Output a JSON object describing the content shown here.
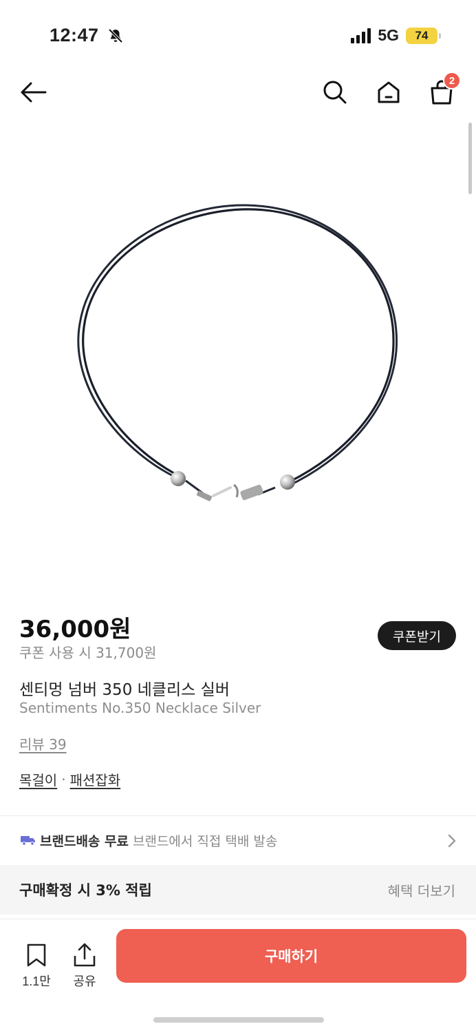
{
  "status_bar": {
    "time": "12:47",
    "network": "5G",
    "battery": "74"
  },
  "nav": {
    "cart_count": "2"
  },
  "product": {
    "price": "36,000원",
    "coupon_price": "쿠폰 사용 시 31,700원",
    "coupon_button": "쿠폰받기",
    "title_ko": "센티멍 넘버 350 네클리스 실버",
    "title_en": "Sentiments No.350 Necklace Silver",
    "review_link": "리뷰 39",
    "categories": [
      "목걸이",
      "패션잡화"
    ],
    "category_separator": "·"
  },
  "shipping": {
    "label": "브랜드배송 무료",
    "description": "브랜드에서 직접 택배 발송"
  },
  "benefit": {
    "title": "구매확정 시 3% 적립",
    "more": "혜택 더보기"
  },
  "bottom_bar": {
    "wishlist_count": "1.1만",
    "share_label": "공유",
    "buy_label": "구매하기"
  },
  "colors": {
    "accent": "#ef5f52",
    "badge": "#ee5a4c",
    "battery": "#f3d341",
    "truck": "#6a6fd8"
  }
}
